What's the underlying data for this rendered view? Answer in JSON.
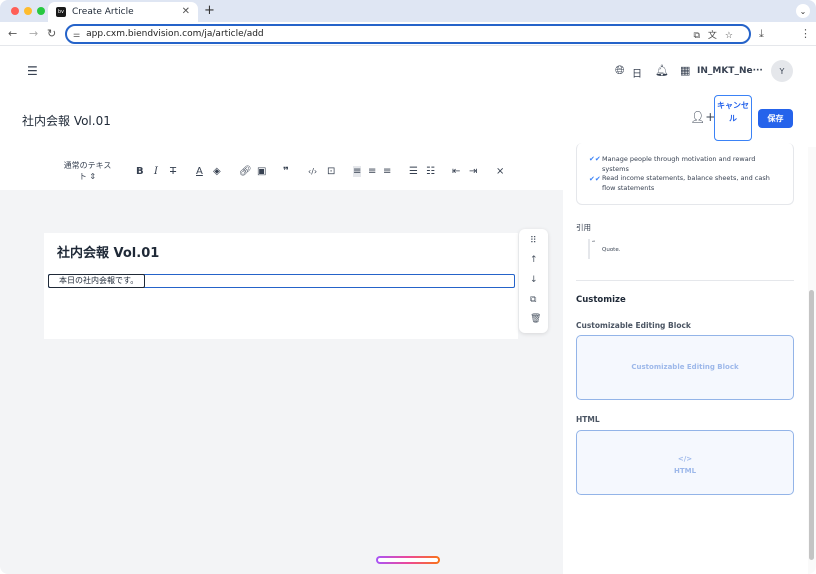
{
  "browser": {
    "tab_title": "Create Article",
    "favicon_text": "bv",
    "url": "app.cxm.biendvision.com/ja/article/add"
  },
  "header": {
    "language": "日",
    "org_name": "IN_MKT_Ne···",
    "avatar_initial": "Y"
  },
  "page": {
    "title": "社内会報 Vol.01",
    "cancel_label": "キャンセル",
    "save_label": "保存"
  },
  "toolbar": {
    "text_style": "通常のテキスト"
  },
  "editor": {
    "heading": "社内会報 Vol.01",
    "paragraph": "本日の社内会報です。"
  },
  "panel": {
    "list_items": [
      "Manage people through motivation and reward systems",
      "Read income statements, balance sheets, and cash flow statements"
    ],
    "quote_label": "引用",
    "quote_mark": "“",
    "quote_text": "Quote.",
    "customize_heading": "Customize",
    "custom_block_label": "Customizable Editing Block",
    "custom_block_text": "Customizable Editing Block",
    "html_label": "HTML",
    "html_block_icon": "</>",
    "html_block_text": "HTML"
  },
  "colors": {
    "accent": "#2563eb",
    "block_border": "#93b4e8",
    "block_bg": "#f5f8fe"
  }
}
